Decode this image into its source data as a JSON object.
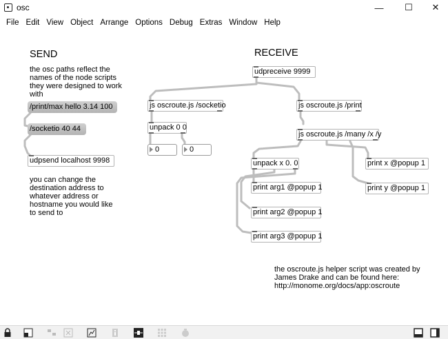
{
  "window": {
    "title": "osc",
    "minimize": "—",
    "maximize": "☐",
    "close": "✕"
  },
  "menu": [
    "File",
    "Edit",
    "View",
    "Object",
    "Arrange",
    "Options",
    "Debug",
    "Extras",
    "Window",
    "Help"
  ],
  "send": {
    "heading": "SEND",
    "comment_lines": [
      "the osc paths reflect the",
      "names of the node scripts",
      "they were designed to work",
      "with"
    ],
    "msg_print": "/print/max hello 3.14 100",
    "msg_socketio": "/socketio 40 44",
    "udpsend": "udpsend localhost 9998",
    "note_lines": [
      "you can change the",
      "destination address to",
      "whatever address or",
      "hostname you would like",
      "to send to"
    ]
  },
  "receive": {
    "heading": "RECEIVE",
    "udpreceive": "udpreceive 9999",
    "js_socketio": "js oscroute.js /socketio",
    "js_print": "js oscroute.js /print",
    "unpack_00": "unpack 0 0",
    "num1": "0",
    "num2": "0",
    "js_many": "js oscroute.js /many /x /y",
    "unpack_x": "unpack x 0. 0",
    "print_x": "print x @popup 1",
    "print_y": "print y @popup 1",
    "print_arg1": "print arg1 @popup 1",
    "print_arg2": "print arg2 @popup 1",
    "print_arg3": "print arg3 @popup 1"
  },
  "credit_lines": [
    "the oscroute.js helper script was created by",
    "James Drake and can be found here:",
    "http://monome.org/docs/app:oscroute"
  ]
}
